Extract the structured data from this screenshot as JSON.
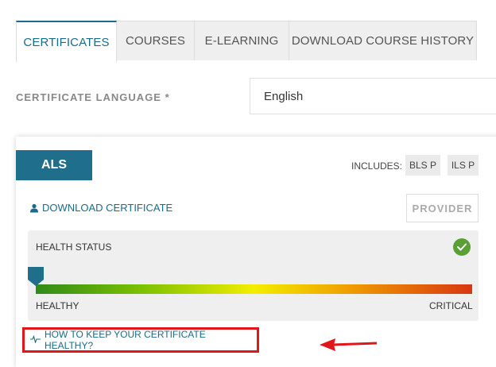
{
  "tabs": [
    {
      "label": "CERTIFICATES",
      "active": true
    },
    {
      "label": "COURSES",
      "active": false
    },
    {
      "label": "E-LEARNING",
      "active": false
    },
    {
      "label": "DOWNLOAD COURSE HISTORY",
      "active": false
    }
  ],
  "language": {
    "label": "CERTIFICATE LANGUAGE *",
    "value": "English"
  },
  "certificate": {
    "name": "ALS",
    "includes_label": "INCLUDES:",
    "includes": [
      "BLS P",
      "ILS P"
    ],
    "download_label": "DOWNLOAD CERTIFICATE",
    "role_button": "PROVIDER",
    "health": {
      "title": "HEALTH STATUS",
      "level": 0.0,
      "min_label": "HEALTHY",
      "max_label": "CRITICAL",
      "status": "healthy"
    },
    "howto_label": "HOW TO KEEP YOUR CERTIFICATE HEALTHY?"
  },
  "colors": {
    "accent": "#1a6b8a",
    "badge": "#1f6e8c",
    "highlight": "#e0161b",
    "ok": "#5ba034"
  },
  "icons": {
    "download": "user-icon",
    "health_ok": "check-circle-icon",
    "howto": "pulse-icon",
    "annotation": "red-arrow"
  }
}
